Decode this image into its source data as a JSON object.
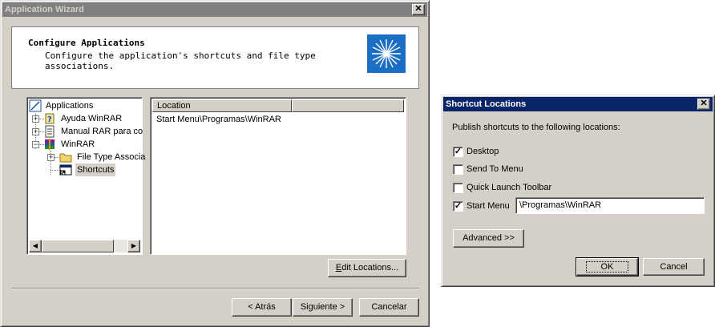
{
  "wizard": {
    "title": "Application Wizard",
    "header_title": "Configure Applications",
    "header_desc_line1": "Configure the application's shortcuts and file type",
    "header_desc_line2": "associations.",
    "tree": [
      {
        "label": "Applications",
        "icon": "applications-icon"
      },
      {
        "label": "Ayuda WinRAR",
        "icon": "help-document-icon"
      },
      {
        "label": "Manual RAR para co",
        "icon": "document-icon"
      },
      {
        "label": "WinRAR",
        "icon": "winrar-icon"
      },
      {
        "label": "File Type Associa",
        "icon": "folder-icon"
      },
      {
        "label": "Shortcuts",
        "icon": "shortcut-icon",
        "selected": true
      }
    ],
    "list": {
      "columns": [
        "Location",
        ""
      ],
      "rows": [
        "Start Menu\\Programas\\WinRAR"
      ]
    },
    "edit_locations_label": "Edit Locations...",
    "back_label": "< Atrás",
    "next_label": "Siguiente >",
    "cancel_label": "Cancelar"
  },
  "shortcut_dialog": {
    "title": "Shortcut Locations",
    "prompt": "Publish shortcuts to the following locations:",
    "options": [
      {
        "label": "Desktop",
        "checked": true
      },
      {
        "label": "Send To Menu",
        "checked": false
      },
      {
        "label": "Quick Launch Toolbar",
        "checked": false
      },
      {
        "label": "Start Menu",
        "checked": true
      }
    ],
    "start_menu_path": "\\Programas\\WinRAR",
    "advanced_label": "Advanced >>",
    "ok_label": "OK",
    "cancel_label": "Cancel"
  }
}
